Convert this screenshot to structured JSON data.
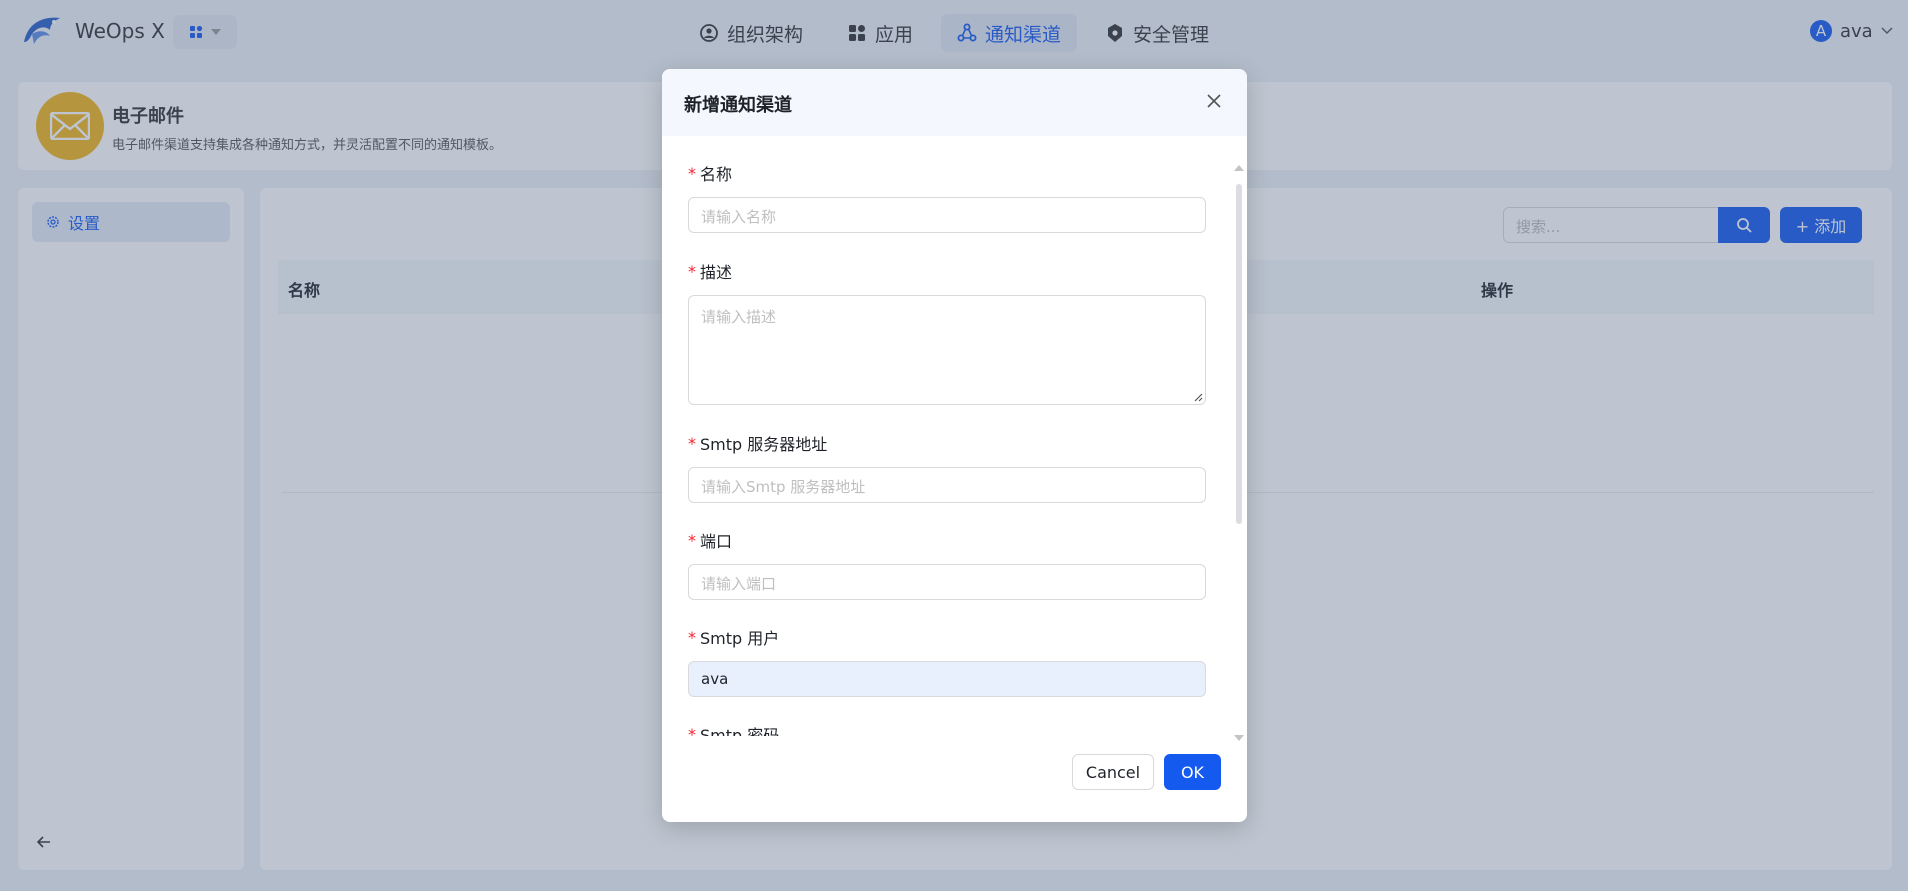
{
  "topbar": {
    "app_name": "WeOps X",
    "nav": [
      {
        "label": "组织架构",
        "icon": "user-circle-icon",
        "active": false
      },
      {
        "label": "应用",
        "icon": "apps-grid-icon",
        "active": false
      },
      {
        "label": "通知渠道",
        "icon": "share-nodes-icon",
        "active": true
      },
      {
        "label": "安全管理",
        "icon": "shield-gear-icon",
        "active": false
      }
    ],
    "user": {
      "initial": "A",
      "name": "ava"
    }
  },
  "banner": {
    "title": "电子邮件",
    "description": "电子邮件渠道支持集成各种通知方式，并灵活配置不同的通知模板。",
    "icon": "mail-icon"
  },
  "sidebar": {
    "items": [
      {
        "label": "设置",
        "icon": "gear-icon"
      }
    ]
  },
  "main": {
    "search_placeholder": "搜索...",
    "add_label": "+ 添加",
    "columns": {
      "name": "名称",
      "action": "操作"
    }
  },
  "modal": {
    "title": "新增通知渠道",
    "fields": [
      {
        "label": "名称",
        "placeholder": "请输入名称",
        "value": "",
        "required": true
      },
      {
        "label": "描述",
        "placeholder": "请输入描述",
        "value": "",
        "required": true
      },
      {
        "label": "Smtp 服务器地址",
        "placeholder": "请输入Smtp 服务器地址",
        "value": "",
        "required": true
      },
      {
        "label": "端口",
        "placeholder": "请输入端口",
        "value": "",
        "required": true
      },
      {
        "label": "Smtp 用户",
        "placeholder": "",
        "value": "ava",
        "required": true
      },
      {
        "label": "Smtp 密码",
        "placeholder": "",
        "value": "",
        "required": true
      }
    ],
    "cancel_label": "Cancel",
    "ok_label": "OK"
  },
  "colors": {
    "primary": "#155aef",
    "required": "#f5222d",
    "banner_icon_bg": "#f2b51d"
  }
}
